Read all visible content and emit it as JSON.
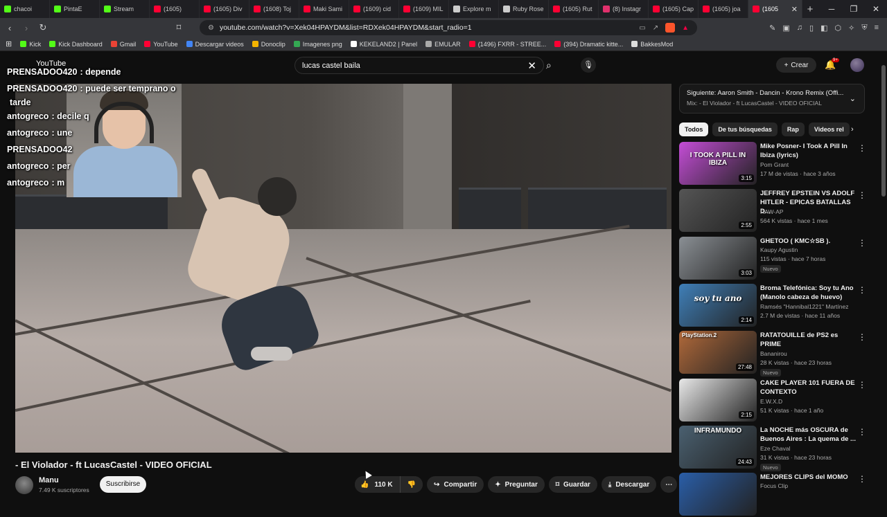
{
  "browser": {
    "tabs": [
      {
        "label": "chacoi",
        "color": "#53fc18"
      },
      {
        "label": "PintaE",
        "color": "#53fc18"
      },
      {
        "label": "Stream",
        "color": "#53fc18"
      },
      {
        "label": "(1605)",
        "color": "#ff0033"
      },
      {
        "label": "(1605) Div",
        "color": "#ff0033"
      },
      {
        "label": "(1608) Toj",
        "color": "#ff0033"
      },
      {
        "label": "Maki Sami",
        "color": "#ff0033"
      },
      {
        "label": "(1609) cid",
        "color": "#ff0033"
      },
      {
        "label": "(1609) MIL",
        "color": "#ff0033"
      },
      {
        "label": "Explore m",
        "color": "#cccccc"
      },
      {
        "label": "Ruby Rose",
        "color": "#cccccc"
      },
      {
        "label": "(1605) Rut",
        "color": "#ff0033"
      },
      {
        "label": "(8) Instagr",
        "color": "#e1306c"
      },
      {
        "label": "(1605) Cap",
        "color": "#ff0033"
      },
      {
        "label": "(1605) joa",
        "color": "#ff0033"
      },
      {
        "label": "(1605",
        "color": "#ff0033"
      }
    ],
    "url": "youtube.com/watch?v=Xek04HPAYDM&list=RDXek04HPAYDM&start_radio=1",
    "bookmarks": [
      {
        "label": "Kick",
        "color": "#53fc18"
      },
      {
        "label": "Kick Dashboard",
        "color": "#53fc18"
      },
      {
        "label": "Gmail",
        "color": "#ea4335"
      },
      {
        "label": "YouTube",
        "color": "#ff0033"
      },
      {
        "label": "Descargar videos",
        "color": "#4285f4"
      },
      {
        "label": "Donoclip",
        "color": "#f4b400"
      },
      {
        "label": "Imagenes png",
        "color": "#34a853"
      },
      {
        "label": "KEKELAND2 | Panel",
        "color": "#ffffff"
      },
      {
        "label": "EMULAR",
        "color": "#aaaaaa"
      },
      {
        "label": "(1496) FXRR - STREE...",
        "color": "#ff0033"
      },
      {
        "label": "(394) Dramatic kitte...",
        "color": "#ff0033"
      },
      {
        "label": "BakkesMod",
        "color": "#dddddd"
      }
    ]
  },
  "youtube": {
    "logo_text": "YouTube",
    "search_value": "lucas castel baila",
    "create_label": "Crear",
    "notif_badge": "9+"
  },
  "chat": [
    {
      "user": "PRENSADOO420",
      "msg": ": depende"
    },
    {
      "user": "PRENSADOO420",
      "msg": ": puede ser temprano o"
    },
    {
      "user": "",
      "msg": "tarde"
    },
    {
      "user": "antogreco",
      "msg": ": decile q"
    },
    {
      "user": "antogreco",
      "msg": ": une"
    },
    {
      "user": "PRENSADOO42",
      "msg": ""
    },
    {
      "user": "antogreco",
      "msg": ": per"
    },
    {
      "user": "antogreco",
      "msg": ": m"
    }
  ],
  "video": {
    "title": "- El Violador - ft LucasCastel - VIDEO OFICIAL",
    "channel": "Manu",
    "subscribers": "7.49 K suscriptores",
    "subscribe_label": "Suscribirse",
    "likes": "110 K",
    "share_label": "Compartir",
    "ask_label": "Preguntar",
    "save_label": "Guardar",
    "download_label": "Descargar"
  },
  "up_next": {
    "title": "Siguiente: Aaron Smith - Dancin - Krono Remix (Offi...",
    "sub": "Mix: - El Violador - ft LucasCastel - VIDEO OFICIAL"
  },
  "chips": [
    "Todos",
    "De tus búsquedas",
    "Rap",
    "Videos rel"
  ],
  "recommendations": [
    {
      "title": "Mike Posner- I Took A Pill In Ibiza (lyrics)",
      "channel": "Pom Grant",
      "meta": "17 M de vistas · hace 3 años",
      "duration": "3:15",
      "new": "",
      "thumb_text": "I TOOK A PILL IN IBIZA",
      "thumb_color": "#c44dd6"
    },
    {
      "title": "JEFFREY EPSTEIN VS ADOLF HITLER - EPICAS BATALLAS D...",
      "channel": "RAW-AP",
      "meta": "564 K vistas · hace 1 mes",
      "duration": "2:55",
      "new": "",
      "thumb_text": "",
      "thumb_color": "#555555"
    },
    {
      "title": "GHETOO ( KMC☆SB ).",
      "channel": "Kaupy Agustin",
      "meta": "115 vistas · hace 7 horas",
      "duration": "3:03",
      "new": "Nuevo",
      "thumb_text": "",
      "thumb_color": "#8a8f94"
    },
    {
      "title": "Broma Telefónica: Soy tu Ano (Manolo cabeza de huevo)",
      "channel": "Ramsés \"Hannibal1221\" Martínez",
      "meta": "2.7 M de vistas · hace 11 años",
      "duration": "2:14",
      "new": "",
      "thumb_text": "soy tu ano",
      "thumb_color": "#3f7fb8"
    },
    {
      "title": "RATATOUILLE de PS2 es PRIME",
      "channel": "Bananirou",
      "meta": "28 K vistas · hace 23 horas",
      "duration": "27:48",
      "new": "Nuevo",
      "thumb_text": "PlayStation.2",
      "thumb_color": "#b0693a"
    },
    {
      "title": "CAKE PLAYER 101 FUERA DE CONTEXTO",
      "channel": "E.W.X.D",
      "meta": "51 K vistas · hace 1 año",
      "duration": "2:15",
      "new": "",
      "thumb_text": "",
      "thumb_color": "#e8e8e8"
    },
    {
      "title": "La NOCHE más OSCURA de Buenos Aires : La quema de ...",
      "channel": "Eze Chaval",
      "meta": "31 K vistas · hace 23 horas",
      "duration": "24:43",
      "new": "Nuevo",
      "thumb_text": "INFRAMUNDO",
      "thumb_color": "#4a6070"
    },
    {
      "title": "MEJORES CLIPS del MOMO",
      "channel": "Focus Clip",
      "meta": "",
      "duration": "",
      "new": "",
      "thumb_text": "",
      "thumb_color": "#2a5ea8"
    }
  ]
}
